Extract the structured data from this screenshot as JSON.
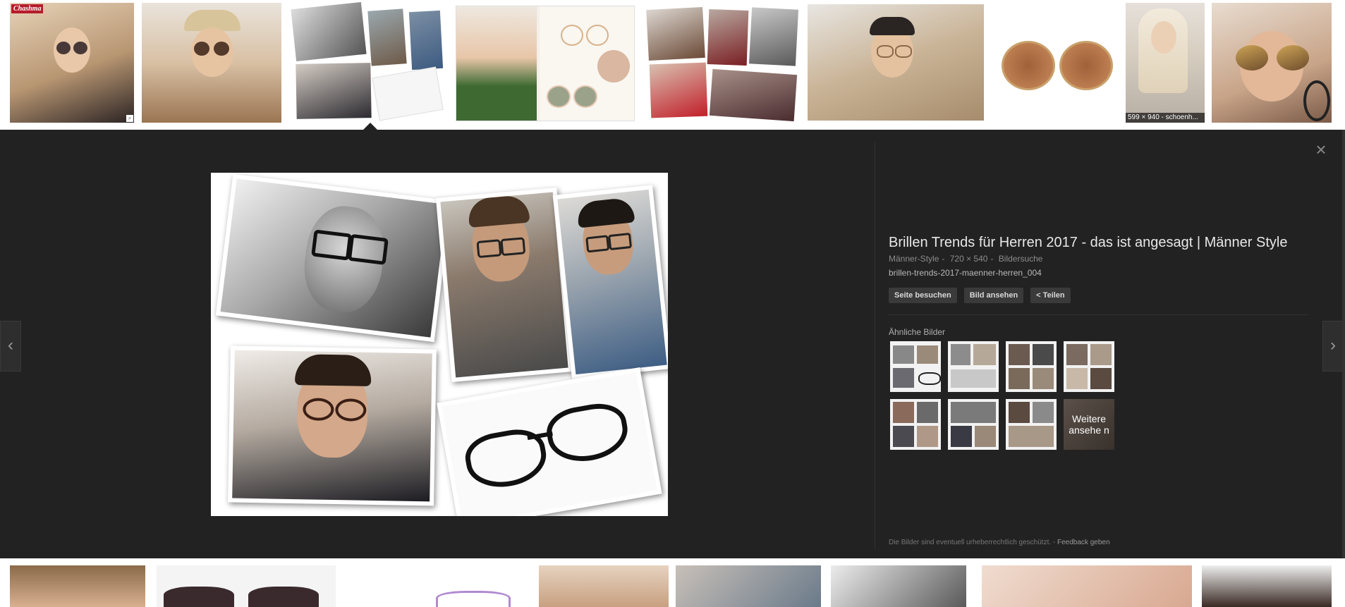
{
  "top_thumbs": [
    {
      "badge": "Chashma"
    },
    {},
    {},
    {},
    {},
    {},
    {},
    {
      "size_label": "599 × 940 - schoenh..."
    },
    {}
  ],
  "preview": {
    "title": "Brillen Trends für Herren 2017 - das ist angesagt | Männer Style",
    "source": "Männer-Style",
    "dimensions": "720 × 540",
    "type": "Bildersuche",
    "filename": "brillen-trends-2017-maenner-herren_004",
    "buttons": {
      "visit": "Seite besuchen",
      "view": "Bild ansehen",
      "share": "Teilen"
    },
    "close_symbol": "×",
    "prev_symbol": "‹",
    "next_symbol": "›"
  },
  "similar": {
    "heading": "Ähnliche Bilder",
    "more_label": "Weitere ansehe n",
    "count": 8
  },
  "footer": {
    "notice": "Die Bilder sind eventuell urheberrechtlich geschützt.",
    "separator": " - ",
    "feedback": "Feedback geben"
  },
  "colors": {
    "panel_bg": "#222222",
    "badge_red": "#b81b2b"
  },
  "icons": {
    "close": "close-icon",
    "prev": "chevron-left-icon",
    "next": "chevron-right-icon",
    "share": "share-icon"
  }
}
